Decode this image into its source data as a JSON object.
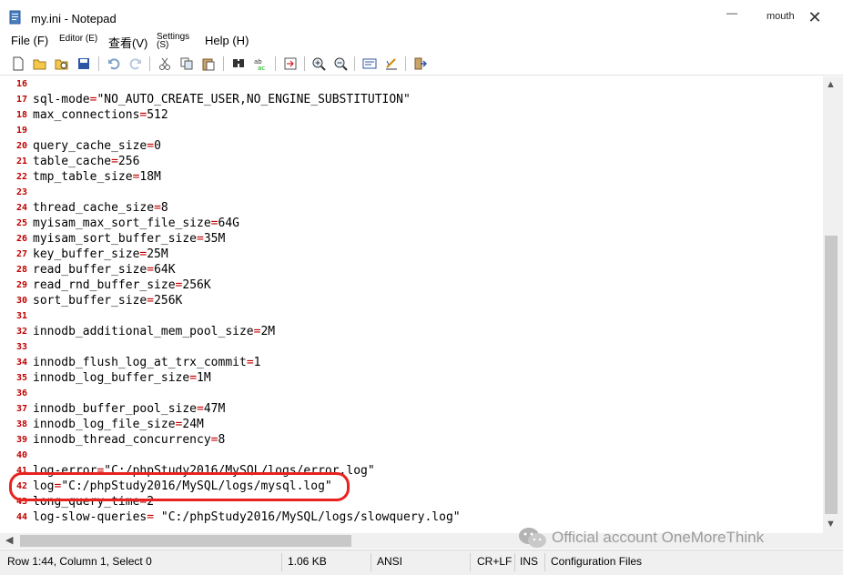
{
  "window": {
    "title": "my.ini - Notepad",
    "user": "mouth",
    "minimize_glyph": "—",
    "close_glyph": "✕"
  },
  "menu": {
    "file": "File (F)",
    "editor": "Editor (E)",
    "view": "查看(V)",
    "settings_1": "Settings",
    "settings_2": "(S)",
    "help": "Help (H)"
  },
  "toolbar_icons": [
    "new-file-icon",
    "open-folder-icon",
    "open-recent-icon",
    "save-icon",
    "undo-icon",
    "redo-icon",
    "cut-icon",
    "copy-icon",
    "paste-icon",
    "find-icon",
    "replace-icon",
    "goto-icon",
    "zoom-in-icon",
    "zoom-out-icon",
    "word-wrap-icon",
    "scheme-icon",
    "exit-icon"
  ],
  "editor": {
    "lines": [
      {
        "n": "16",
        "key": "",
        "val": ""
      },
      {
        "n": "17",
        "key": "sql-mode",
        "val": "\"NO_AUTO_CREATE_USER,NO_ENGINE_SUBSTITUTION\""
      },
      {
        "n": "18",
        "key": "max_connections",
        "val": "512"
      },
      {
        "n": "19",
        "key": "",
        "val": ""
      },
      {
        "n": "20",
        "key": "query_cache_size",
        "val": "0"
      },
      {
        "n": "21",
        "key": "table_cache",
        "val": "256"
      },
      {
        "n": "22",
        "key": "tmp_table_size",
        "val": "18M"
      },
      {
        "n": "23",
        "key": "",
        "val": ""
      },
      {
        "n": "24",
        "key": "thread_cache_size",
        "val": "8"
      },
      {
        "n": "25",
        "key": "myisam_max_sort_file_size",
        "val": "64G"
      },
      {
        "n": "26",
        "key": "myisam_sort_buffer_size",
        "val": "35M"
      },
      {
        "n": "27",
        "key": "key_buffer_size",
        "val": "25M"
      },
      {
        "n": "28",
        "key": "read_buffer_size",
        "val": "64K"
      },
      {
        "n": "29",
        "key": "read_rnd_buffer_size",
        "val": "256K"
      },
      {
        "n": "30",
        "key": "sort_buffer_size",
        "val": "256K"
      },
      {
        "n": "31",
        "key": "",
        "val": ""
      },
      {
        "n": "32",
        "key": "innodb_additional_mem_pool_size",
        "val": "2M"
      },
      {
        "n": "33",
        "key": "",
        "val": ""
      },
      {
        "n": "34",
        "key": "innodb_flush_log_at_trx_commit",
        "val": "1"
      },
      {
        "n": "35",
        "key": "innodb_log_buffer_size",
        "val": "1M"
      },
      {
        "n": "36",
        "key": "",
        "val": ""
      },
      {
        "n": "37",
        "key": "innodb_buffer_pool_size",
        "val": "47M"
      },
      {
        "n": "38",
        "key": "innodb_log_file_size",
        "val": "24M"
      },
      {
        "n": "39",
        "key": "innodb_thread_concurrency",
        "val": "8"
      },
      {
        "n": "40",
        "key": "",
        "val": ""
      },
      {
        "n": "41",
        "key": "log-error",
        "val": "\"C:/phpStudy2016/MySQL/logs/error.log\""
      },
      {
        "n": "42",
        "key": "log",
        "val": "\"C:/phpStudy2016/MySQL/logs/mysql.log\""
      },
      {
        "n": "43",
        "key": "long_query_time",
        "val": "2"
      },
      {
        "n": "44",
        "key": "log-slow-queries",
        "val": " \"C:/phpStudy2016/MySQL/logs/slowquery.log\""
      }
    ]
  },
  "watermark": {
    "text": "Official account OneMoreThink"
  },
  "status": {
    "position": "Row 1:44, Column 1, Select 0",
    "size": "1.06 KB",
    "encoding": "ANSI",
    "line_ending": "CR+LF",
    "mode": "INS",
    "scheme": "Configuration Files"
  },
  "scrollbar": {
    "up": "▲",
    "down": "▼",
    "left": "◀"
  }
}
